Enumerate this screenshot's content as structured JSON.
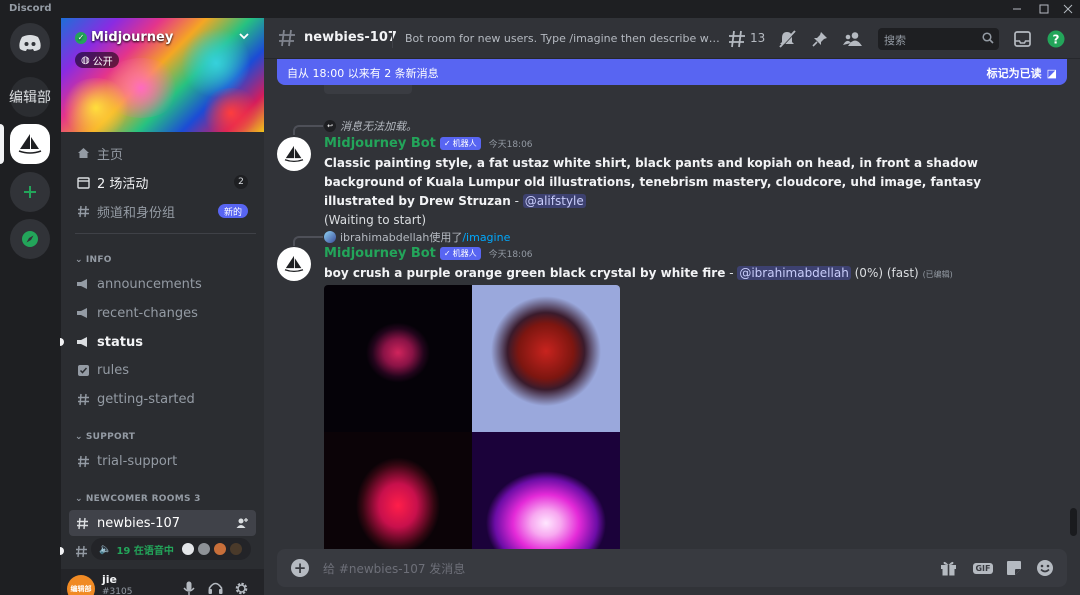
{
  "window": {
    "app_name": "Discord"
  },
  "guilds": {
    "home_icon": "discord-logo-icon",
    "folder_label": "编辑部",
    "active_server_icon": "sailboat-icon",
    "add_icon": "plus-icon",
    "explore_icon": "compass-icon"
  },
  "server": {
    "name": "Midjourney",
    "public_label": "公开",
    "nav": {
      "home": "主页",
      "events": "2 场活动",
      "events_count": "2",
      "channels_roles": "频道和身份组",
      "new_badge": "新的"
    }
  },
  "categories": [
    {
      "name": "INFO",
      "channels": [
        "announcements",
        "recent-changes",
        "status",
        "rules",
        "getting-started"
      ]
    },
    {
      "name": "SUPPORT",
      "channels": [
        "trial-support"
      ]
    },
    {
      "name": "NEWCOMER ROOMS 3",
      "channels": [
        "newbies-107"
      ]
    }
  ],
  "voice": {
    "label": "19 在语音中"
  },
  "user": {
    "avatar_text": "编辑部",
    "name": "jie",
    "tag": "#3105"
  },
  "channel": {
    "name": "newbies-107",
    "topic": "Bot room for new users. Type /imagine then describe what y...",
    "threads_count": "13",
    "search_placeholder": "搜索"
  },
  "new_messages": {
    "text": "自从 18:00 以来有 2 条新消息",
    "mark_read": "标记为已读"
  },
  "messages": [
    {
      "reply_text": "消息无法加载。",
      "author": "Midjourney Bot",
      "app_tag": "机器人",
      "time": "今天18:06",
      "prompt": "Classic painting style, a fat ustaz white shirt, black pants and kopiah on head, in front a shadow background of Kuala Lumpur old illustrations, tenebrism mastery, cloudcore, uhd image, fantasy illustrated by Drew Struzan",
      "separator": " - ",
      "mention": "@alifstyle",
      "status": "(Waiting to start)"
    },
    {
      "reply_user": "ibrahimabdellah",
      "reply_used": "使用了",
      "reply_cmd": "/imagine",
      "author": "Midjourney Bot",
      "app_tag": "机器人",
      "time": "今天18:06",
      "prompt": "boy crush a purple orange green black crystal by white fire",
      "separator": " - ",
      "mention": "@ibrahimabdellah",
      "status": " (0%) (fast) ",
      "edited": "(已编辑)"
    }
  ],
  "composer": {
    "placeholder": "给 #newbies-107 发消息",
    "gif_label": "GIF"
  },
  "colors": {
    "accent": "#5865f2",
    "online": "#23a55a",
    "bg": "#313338",
    "sidebar": "#2b2d31"
  }
}
